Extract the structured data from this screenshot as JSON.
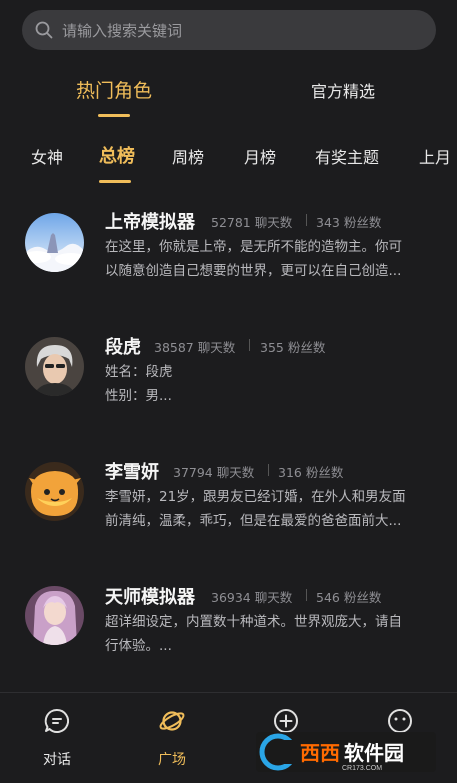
{
  "search": {
    "placeholder": "请输入搜索关键词"
  },
  "main_tabs": [
    {
      "label": "热门角色",
      "active": true
    },
    {
      "label": "官方精选",
      "active": false
    }
  ],
  "sub_tabs": [
    {
      "label": "女神"
    },
    {
      "label": "总榜",
      "active": true
    },
    {
      "label": "周榜"
    },
    {
      "label": "月榜"
    },
    {
      "label": "有奖主题"
    },
    {
      "label": "上月"
    }
  ],
  "characters": [
    {
      "name": "上帝模拟器",
      "chats": "52781 聊天数",
      "fans": "343 粉丝数",
      "desc_lines": [
        "在这里，你就是上帝，是无所不能的造物主。你可",
        "以随意创造自己想要的世界，更可以在自己创造..."
      ],
      "avatar_icon": "cloud-landscape-avatar"
    },
    {
      "name": "段虎",
      "chats": "38587 聊天数",
      "fans": "355 粉丝数",
      "desc_lines": [
        "姓名：段虎",
        "性别：男..."
      ],
      "avatar_icon": "silver-hair-man-avatar"
    },
    {
      "name": "李雪妍",
      "chats": "37794 聊天数",
      "fans": "316 粉丝数",
      "desc_lines": [
        "李雪妍，21岁，跟男友已经订婚，在外人和男友面",
        "前清纯，温柔，乖巧，但是在最爱的爸爸面前大..."
      ],
      "avatar_icon": "orange-cartoon-avatar"
    },
    {
      "name": "天师模拟器",
      "chats": "36934 聊天数",
      "fans": "546 粉丝数",
      "desc_lines": [
        "超详细设定，内置数十种道术。世界观庞大，请自",
        "行体验。..."
      ],
      "avatar_icon": "anime-girl-avatar"
    }
  ],
  "bottom_nav": [
    {
      "label": "对话",
      "icon": "chat-icon",
      "active": false
    },
    {
      "label": "广场",
      "icon": "planet-icon",
      "active": true
    },
    {
      "label": "",
      "icon": "plus-circle-icon",
      "active": false
    },
    {
      "label": "",
      "icon": "face-icon",
      "active": false
    }
  ],
  "watermark": {
    "text": "西西软件园",
    "sub": "CR173.COM"
  },
  "colors": {
    "accent": "#f0bd5a",
    "background": "#1c1c1e"
  }
}
